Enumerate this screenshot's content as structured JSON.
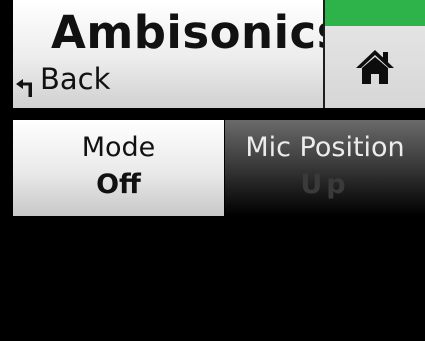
{
  "header": {
    "title": "Ambisonics",
    "back_label": "Back",
    "status_color": "#2db34a",
    "home_icon": "home-icon"
  },
  "controls": [
    {
      "label": "Mode",
      "value": "Off",
      "state": "normal"
    },
    {
      "label": "Mic Position",
      "value": "Up",
      "state": "disabled"
    }
  ]
}
